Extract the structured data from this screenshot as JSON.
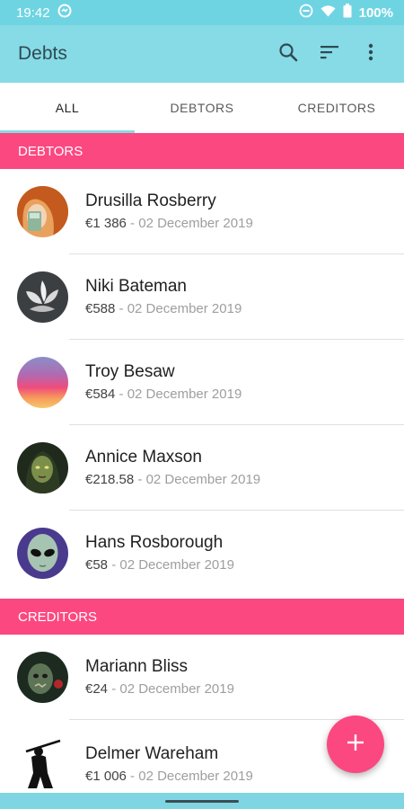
{
  "status_bar": {
    "time": "19:42",
    "battery": "100%"
  },
  "app_bar": {
    "title": "Debts",
    "icons": [
      "search-icon",
      "sort-icon",
      "more-vert-icon"
    ]
  },
  "tabs": [
    {
      "label": "ALL",
      "active": true
    },
    {
      "label": "DEBTORS",
      "active": false
    },
    {
      "label": "CREDITORS",
      "active": false
    }
  ],
  "sections": {
    "debtors": {
      "title": "DEBTORS",
      "items": [
        {
          "name": "Drusilla Rosberry",
          "amount": "€1 386",
          "date": " - 02 December 2019"
        },
        {
          "name": "Niki Bateman",
          "amount": "€588",
          "date": " - 02 December 2019"
        },
        {
          "name": "Troy Besaw",
          "amount": "€584",
          "date": " - 02 December 2019"
        },
        {
          "name": "Annice Maxson",
          "amount": "€218.58",
          "date": " - 02 December 2019"
        },
        {
          "name": "Hans Rosborough",
          "amount": "€58",
          "date": " - 02 December 2019"
        }
      ]
    },
    "creditors": {
      "title": "CREDITORS",
      "items": [
        {
          "name": "Mariann Bliss",
          "amount": "€24",
          "date": " - 02 December 2019"
        },
        {
          "name": "Delmer Wareham",
          "amount": "€1 006",
          "date": " - 02 December 2019"
        }
      ]
    }
  },
  "fab": {
    "icon": "plus-icon"
  },
  "colors": {
    "primary": "#86dbe6",
    "accent": "#fb4881",
    "status_bar": "#6fd4e2"
  }
}
